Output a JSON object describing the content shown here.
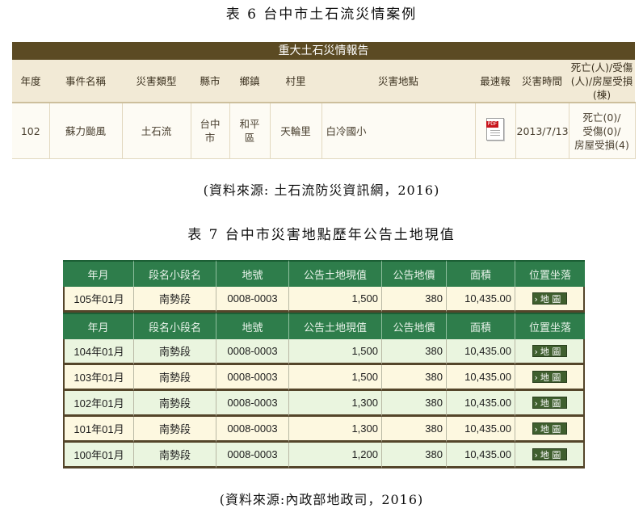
{
  "table6": {
    "caption": "表 6 台中市土石流災情案例",
    "title": "重大土石災情報告",
    "headers": [
      "年度",
      "事件名稱",
      "災害類型",
      "縣市",
      "鄉鎮",
      "村里",
      "災害地點",
      "最速報",
      "災害時間",
      "死亡(人)/受傷(人)/房屋受損(棟)"
    ],
    "row": {
      "year": "102",
      "event": "蘇力颱風",
      "type": "土石流",
      "county": "台中市",
      "town": "和平區",
      "village": "天輪里",
      "location": "白冷國小",
      "report_icon": "pdf-icon",
      "report_icon_text": "PDF",
      "date": "2013/7/13",
      "casualties": [
        "死亡(0)/",
        "受傷(0)/",
        "房屋受損(4)"
      ]
    },
    "source": "(資料來源: 土石流防災資訊網，2016)"
  },
  "table7": {
    "caption": "表 7 台中市災害地點歷年公告土地現值",
    "headers": [
      "年月",
      "段名小段名",
      "地號",
      "公告土地現值",
      "公告地價",
      "面積",
      "位置坐落"
    ],
    "map_button": "地 圖",
    "groups": [
      {
        "rows": [
          {
            "ym": "105年01月",
            "section": "南勢段",
            "lot": "0008-0003",
            "value": "1,500",
            "price": "380",
            "area": "10,435.00"
          }
        ]
      },
      {
        "rows": [
          {
            "ym": "104年01月",
            "section": "南勢段",
            "lot": "0008-0003",
            "value": "1,500",
            "price": "380",
            "area": "10,435.00"
          },
          {
            "ym": "103年01月",
            "section": "南勢段",
            "lot": "0008-0003",
            "value": "1,500",
            "price": "380",
            "area": "10,435.00"
          },
          {
            "ym": "102年01月",
            "section": "南勢段",
            "lot": "0008-0003",
            "value": "1,300",
            "price": "380",
            "area": "10,435.00"
          },
          {
            "ym": "101年01月",
            "section": "南勢段",
            "lot": "0008-0003",
            "value": "1,300",
            "price": "380",
            "area": "10,435.00"
          },
          {
            "ym": "100年01月",
            "section": "南勢段",
            "lot": "0008-0003",
            "value": "1,200",
            "price": "380",
            "area": "10,435.00"
          }
        ]
      }
    ],
    "source": "(資料來源:內政部地政司，2016)"
  },
  "colors": {
    "t6_title_bg": "#5b4a23",
    "t7_header_bg": "#2e7d4b",
    "t7_odd_row": "#fdf8e0",
    "t7_even_row": "#eaf5df"
  }
}
